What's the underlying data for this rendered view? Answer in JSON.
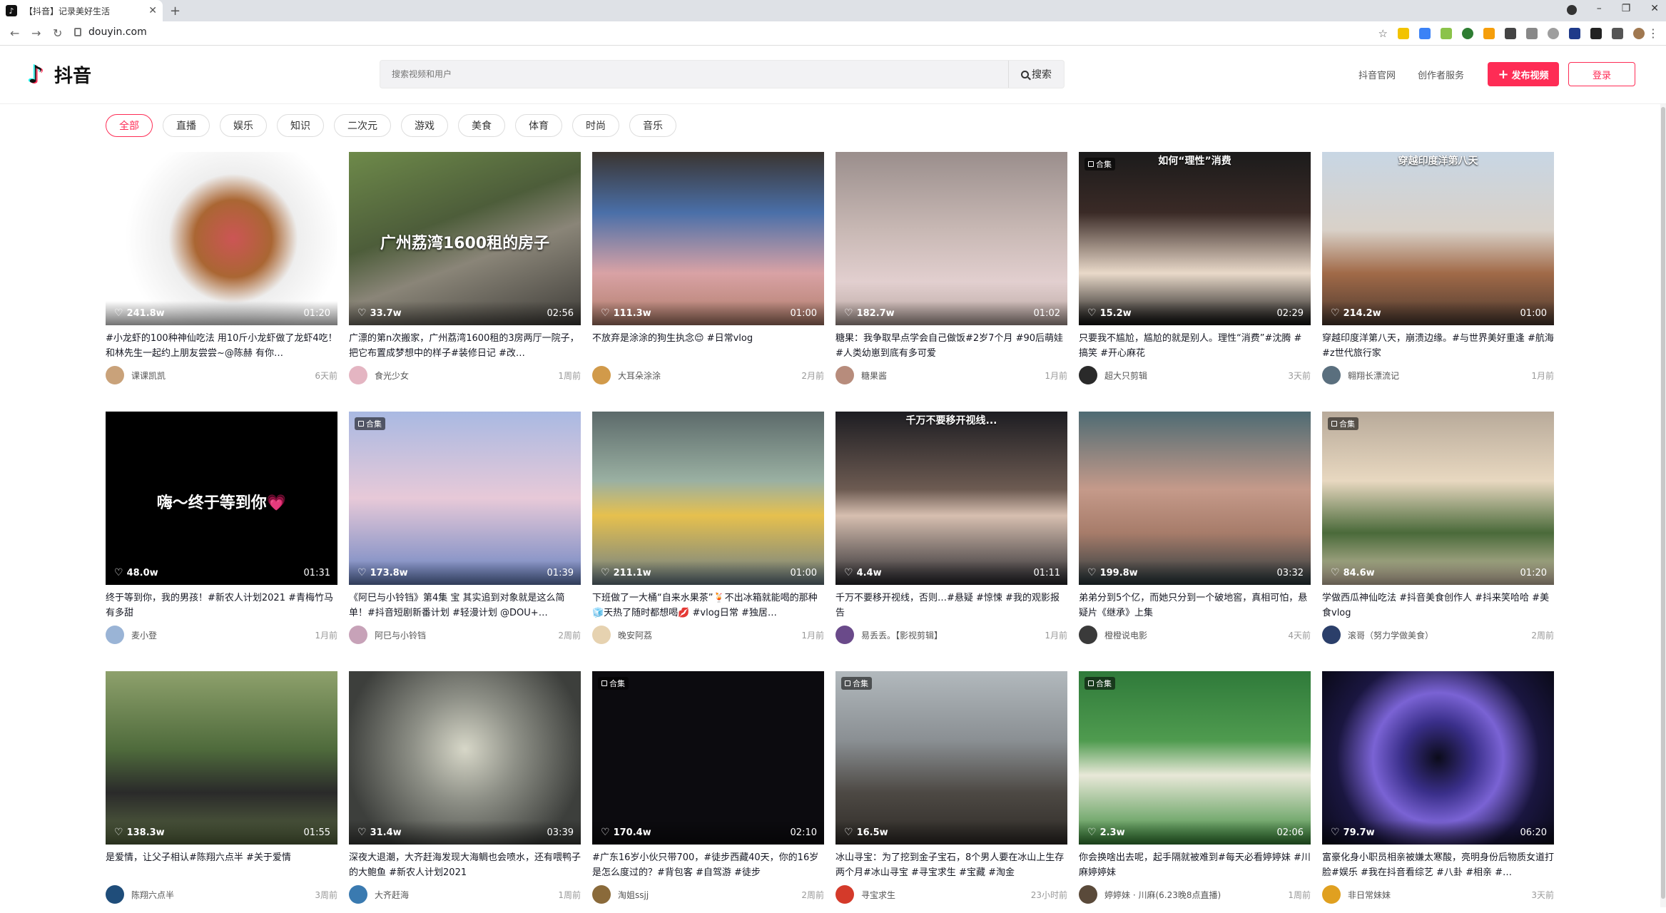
{
  "browser": {
    "tab_title": "【抖音】记录美好生活",
    "favicon": "♪",
    "url": "douyin.com"
  },
  "header": {
    "brand": "抖音",
    "search_placeholder": "搜索视频和用户",
    "search_button": "搜索",
    "link_official": "抖音官网",
    "link_creator": "创作者服务",
    "upload_button": "发布视频",
    "login_button": "登录"
  },
  "categories": [
    "全部",
    "直播",
    "娱乐",
    "知识",
    "二次元",
    "游戏",
    "美食",
    "体育",
    "时尚",
    "音乐"
  ],
  "colors": {
    "accent": "#fe2c55"
  },
  "videos": [
    {
      "likes": "241.8w",
      "duration": "01:20",
      "desc": "#小龙虾的100种神仙吃法 用10斤小龙虾做了龙虾4吃！和林先生一起约上朋友尝尝~@陈赫 有你…",
      "author": "课课凯凯",
      "ago": "6天前",
      "caption": "",
      "topcap": "",
      "collection": false,
      "avatar": "#c9a27a"
    },
    {
      "likes": "33.7w",
      "duration": "02:56",
      "desc": "广漂的第n次搬家，广州荔湾1600租的3房两厅一院子，把它布置成梦想中的样子#装修日记 #改…",
      "author": "食光少女",
      "ago": "1周前",
      "caption": "广州荔湾1600租的房子",
      "topcap": "",
      "collection": false,
      "avatar": "#e4b5c2"
    },
    {
      "likes": "111.3w",
      "duration": "01:00",
      "desc": "不放弃是涂涂的狗生执念😌 #日常vlog",
      "author": "大耳朵涂涂",
      "ago": "2月前",
      "caption": "",
      "topcap": "",
      "collection": false,
      "avatar": "#d19a4a"
    },
    {
      "likes": "182.7w",
      "duration": "01:02",
      "desc": "糖果：我争取早点学会自己做饭#2岁7个月 #90后萌娃 #人类幼崽到底有多可爱",
      "author": "糖果酱",
      "ago": "1月前",
      "caption": "",
      "topcap": "",
      "collection": false,
      "avatar": "#b78c7c"
    },
    {
      "likes": "15.2w",
      "duration": "02:29",
      "desc": "只要我不尴尬，尴尬的就是别人。理性“消费”#沈腾 #搞笑 #开心麻花",
      "author": "超大只剪辑",
      "ago": "3天前",
      "caption": "",
      "topcap": "如何“理性”消费",
      "collection": true,
      "avatar": "#2a2a2a"
    },
    {
      "likes": "214.2w",
      "duration": "01:00",
      "desc": "穿越印度洋第八天，崩溃边缘。#与世界美好重逢 #航海 #z世代旅行家",
      "author": "翱翔长漂流记",
      "ago": "1月前",
      "caption": "",
      "topcap": "穿越印度洋第八天",
      "collection": false,
      "avatar": "#5a6f7e"
    },
    {
      "likes": "48.0w",
      "duration": "01:31",
      "desc": "终于等到你，我的男孩！#新农人计划2021 #青梅竹马有多甜",
      "author": "麦小登",
      "ago": "1月前",
      "caption": "嗨～终于等到你💗",
      "topcap": "",
      "collection": false,
      "avatar": "#9ab4d6"
    },
    {
      "likes": "173.8w",
      "duration": "01:39",
      "desc": "《阿巳与小铃铛》第4集 宝 其实追到对象就是这么简单！#抖音短剧新番计划 #轻漫计划 @DOU+…",
      "author": "阿巳与小铃铛",
      "ago": "2周前",
      "caption": "",
      "topcap": "",
      "collection": true,
      "avatar": "#c7a2b8"
    },
    {
      "likes": "211.1w",
      "duration": "01:00",
      "desc": "下班做了一大桶“自来水果茶”🍹不出冰箱就能喝的那种🧊天热了随时都想喝💋 #vlog日常 #独居…",
      "author": "晚安阿荔",
      "ago": "1月前",
      "caption": "",
      "topcap": "",
      "collection": false,
      "avatar": "#e6d2b0"
    },
    {
      "likes": "4.4w",
      "duration": "01:11",
      "desc": "千万不要移开视线，否则…#悬疑 #惊悚 #我的观影报告",
      "author": "易丢丢。【影视剪辑】",
      "ago": "1月前",
      "caption": "",
      "topcap": "千万不要移开视线...",
      "collection": false,
      "avatar": "#6a4a8a"
    },
    {
      "likes": "199.8w",
      "duration": "03:32",
      "desc": "弟弟分到5个亿，而她只分到一个破地窖，真相可怕，悬疑片《继承》上集",
      "author": "橙橙说电影",
      "ago": "4天前",
      "caption": "",
      "topcap": "",
      "collection": false,
      "avatar": "#3a3a3a"
    },
    {
      "likes": "84.6w",
      "duration": "01:20",
      "desc": "学做西瓜神仙吃法 #抖音美食创作人 #抖来笑哈哈 #美食vlog",
      "author": "滚哥（努力学做美食）",
      "ago": "2周前",
      "caption": "",
      "topcap": "",
      "collection": true,
      "avatar": "#2b3f6a"
    },
    {
      "likes": "138.3w",
      "duration": "01:55",
      "desc": "是爱情，让父子相认#陈翔六点半 #关于爱情",
      "author": "陈翔六点半",
      "ago": "3周前",
      "caption": "",
      "topcap": "",
      "collection": false,
      "avatar": "#1f4d7a"
    },
    {
      "likes": "31.4w",
      "duration": "03:39",
      "desc": "深夜大退潮，大齐赶海发现大海鲷也会喷水，还有喂鸭子的大鲍鱼 #新农人计划2021",
      "author": "大齐赶海",
      "ago": "1周前",
      "caption": "",
      "topcap": "",
      "collection": false,
      "avatar": "#3a7ab0"
    },
    {
      "likes": "170.4w",
      "duration": "02:10",
      "desc": "#广东16岁小伙只带700，#徒步西藏40天，你的16岁是怎么度过的？#背包客 #自驾游 #徒步",
      "author": "淘姐ssjj",
      "ago": "2周前",
      "caption": "",
      "topcap": "",
      "collection": true,
      "avatar": "#8a6a3a"
    },
    {
      "likes": "16.5w",
      "duration": "",
      "desc": "冰山寻宝：为了挖到金子宝石，8个男人要在冰山上生存两个月#冰山寻宝 #寻宝求生 #宝藏 #淘金",
      "author": "寻宝求生",
      "ago": "23小时前",
      "caption": "",
      "topcap": "",
      "collection": true,
      "avatar": "#d43a2a"
    },
    {
      "likes": "2.3w",
      "duration": "02:06",
      "desc": "你会换啥出去呢，起手隔就被难到#每天必看婷婷妹 #川麻婷婷妹",
      "author": "婷婷妹 · 川麻(6.23晚8点直播)",
      "ago": "1周前",
      "caption": "",
      "topcap": "",
      "collection": true,
      "avatar": "#5a4a3a"
    },
    {
      "likes": "79.7w",
      "duration": "06:20",
      "desc": "富豪化身小职员相亲被嫌太寒酸，亮明身份后物质女道打脸#娱乐 #我在抖音看综艺 #八卦 #相亲 #…",
      "author": "非日常妹妹",
      "ago": "3天前",
      "caption": "",
      "topcap": "",
      "collection": false,
      "avatar": "#e0a020"
    }
  ]
}
